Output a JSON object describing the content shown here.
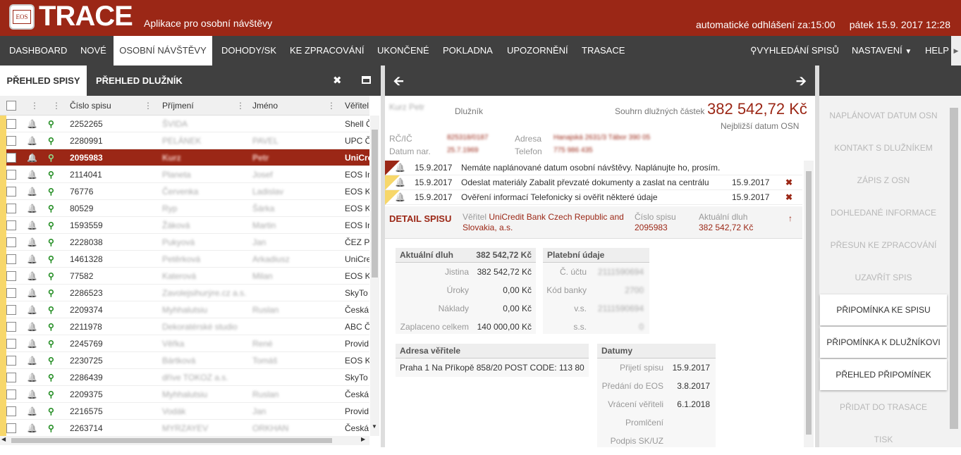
{
  "header": {
    "logo_text": "EOS",
    "brand": "TRACE",
    "subtitle": "Aplikace pro osobní návštěvy",
    "logout": "automatické odhlášení za:15:00",
    "date": "pátek 15.9. 2017 12:28"
  },
  "nav": {
    "items": [
      "DASHBOARD",
      "NOVÉ",
      "OSOBNÍ NÁVŠTĚVY",
      "DOHODY/SK",
      "KE ZPRACOVÁNÍ",
      "UKONČENÉ",
      "POKLADNA",
      "UPOZORNĚNÍ",
      "TRASACE"
    ],
    "search": "VYHLEDÁNÍ SPISŮ",
    "settings": "NASTAVENÍ",
    "help": "HELP"
  },
  "left": {
    "tabs": [
      "PŘEHLED SPISY",
      "PŘEHLED DLUŽNÍK"
    ],
    "columns": {
      "file": "Číslo spisu",
      "surname": "Příjmení",
      "name": "Jméno",
      "creditor": "Věřitel"
    },
    "rows": [
      {
        "file": "2252265",
        "surname": "ŠVIDA",
        "name": "",
        "creditor": "Shell Č"
      },
      {
        "file": "2280991",
        "surname": "PELÁNEK",
        "name": "PAVEL",
        "creditor": "UPC Č"
      },
      {
        "file": "2095983",
        "surname": "Kurz",
        "name": "Petr",
        "creditor": "UniCre"
      },
      {
        "file": "2114041",
        "surname": "Planeta",
        "name": "Josef",
        "creditor": "EOS Ir"
      },
      {
        "file": "76776",
        "surname": "Červenka",
        "name": "Ladislav",
        "creditor": "EOS K"
      },
      {
        "file": "80529",
        "surname": "Ryp",
        "name": "Šárka",
        "creditor": "EOS K"
      },
      {
        "file": "1593559",
        "surname": "Žáková",
        "name": "Martin",
        "creditor": "EOS Ir"
      },
      {
        "file": "2228038",
        "surname": "Pukyová",
        "name": "Jan",
        "creditor": "ČEZ P"
      },
      {
        "file": "1461328",
        "surname": "Petěrková",
        "name": "Arkadiusz",
        "creditor": "UniCre"
      },
      {
        "file": "77582",
        "surname": "Katerová",
        "name": "Milan",
        "creditor": "EOS K"
      },
      {
        "file": "2286523",
        "surname": "Zavolejsihurýre.cz a.s.",
        "name": "",
        "creditor": "SkyTo"
      },
      {
        "file": "2209374",
        "surname": "Myhhalutsiu",
        "name": "Ruslan",
        "creditor": "Česká"
      },
      {
        "file": "2211978",
        "surname": "Dekoratérské studio",
        "name": "",
        "creditor": "ABC Č"
      },
      {
        "file": "2245769",
        "surname": "Věřka",
        "name": "René",
        "creditor": "Provid"
      },
      {
        "file": "2230725",
        "surname": "Bártková",
        "name": "Tomáš",
        "creditor": "EOS K"
      },
      {
        "file": "2286439",
        "surname": "dříve TOKOZ a.s.",
        "name": "",
        "creditor": "SkyTo"
      },
      {
        "file": "2209375",
        "surname": "Myhhalutsiu",
        "name": "Ruslan",
        "creditor": "Česká"
      },
      {
        "file": "2216575",
        "surname": "Vodák",
        "name": "Jan",
        "creditor": "Provid"
      },
      {
        "file": "2263714",
        "surname": "MYRZAYEV",
        "name": "ORKHAN",
        "creditor": "Česká"
      }
    ]
  },
  "detail": {
    "debtor_name": "Kurz Petr",
    "debtor_label": "Dlužník",
    "sum_label": "Souhrn dlužných částek",
    "sum": "382 542,72 Kč",
    "next_osn": "Nejbližší datum OSN",
    "rc_label": "RČ/IČ",
    "rc": "825318/0187",
    "birth_label": "Datum nar.",
    "birth": "25.7.1969",
    "addr_label": "Adresa",
    "addr": "Hanajská 2631/3 Tábor 390 05",
    "tel_label": "Telefon",
    "tel": "775 986 435",
    "alerts": [
      {
        "date": "15.9.2017",
        "text": "Nemáte naplánované datum osobní návštěvy. Naplánujte ho, prosím.",
        "due": ""
      },
      {
        "date": "15.9.2017",
        "text": "Odeslat materiály Zabalit převzaté dokumenty a zaslat na centrálu",
        "due": "15.9.2017"
      },
      {
        "date": "15.9.2017",
        "text": "Ověření informací Telefonicky si ověřit některé údaje",
        "due": "15.9.2017"
      }
    ],
    "ds_title": "DETAIL SPISU",
    "creditor_label": "Věřitel",
    "creditor": "UniCredit Bank Czech Republic and Slovakia, a.s.",
    "file_label": "Číslo spisu",
    "file": "2095983",
    "debt_label": "Aktuální dluh",
    "debt": "382 542,72 Kč",
    "debt_box": {
      "title": "Aktuální dluh",
      "total": "382 542,72 Kč",
      "rows": [
        [
          "Jistina",
          "382 542,72 Kč"
        ],
        [
          "Úroky",
          "0,00 Kč"
        ],
        [
          "Náklady",
          "0,00 Kč"
        ],
        [
          "Zaplaceno celkem",
          "140 000,00 Kč"
        ]
      ]
    },
    "pay_box": {
      "title": "Platební údaje",
      "rows": [
        [
          "Č. účtu",
          "2111590694"
        ],
        [
          "Kód banky",
          "2700"
        ],
        [
          "v.s.",
          "2111590694"
        ],
        [
          "s.s.",
          "0"
        ]
      ]
    },
    "addr_box": {
      "title": "Adresa věřitele",
      "text": "Praha 1 Na Příkopě 858/20 POST CODE: 113 80"
    },
    "dates_box": {
      "title": "Datumy",
      "rows": [
        [
          "Přijetí spisu",
          "15.9.2017"
        ],
        [
          "Předání do EOS",
          "3.8.2017"
        ],
        [
          "Vrácení věřiteli",
          "6.1.2018"
        ],
        [
          "Promlčení",
          ""
        ],
        [
          "Podpis SK/UZ",
          ""
        ]
      ]
    }
  },
  "right": {
    "buttons": [
      {
        "label": "NAPLÁNOVAT DATUM OSN",
        "on": false
      },
      {
        "label": "KONTAKT S DLUŽNÍKEM",
        "on": false
      },
      {
        "label": "ZÁPIS Z OSN",
        "on": false
      },
      {
        "label": "DOHLEDANÉ INFORMACE",
        "on": false
      },
      {
        "label": "PŘESUN KE ZPRACOVÁNÍ",
        "on": false
      },
      {
        "label": "UZAVŘÍT SPIS",
        "on": false
      },
      {
        "label": "PŘIPOMÍNKA KE SPISU",
        "on": true
      },
      {
        "label": "PŘIPOMÍNKA K DLUŽNÍKOVI",
        "on": true
      },
      {
        "label": "PŘEHLED PŘIPOMÍNEK",
        "on": true
      },
      {
        "label": "PŘIDAT DO TRASACE",
        "on": false
      },
      {
        "label": "TISK",
        "on": false
      }
    ]
  },
  "colors": {
    "brand": "#9b2716",
    "nav": "#404040",
    "flag": "#f7d76a"
  },
  "icons": [
    "bell-icon",
    "pin-icon",
    "arrow-left-icon",
    "arrow-right-icon",
    "close-icon",
    "search-icon"
  ]
}
